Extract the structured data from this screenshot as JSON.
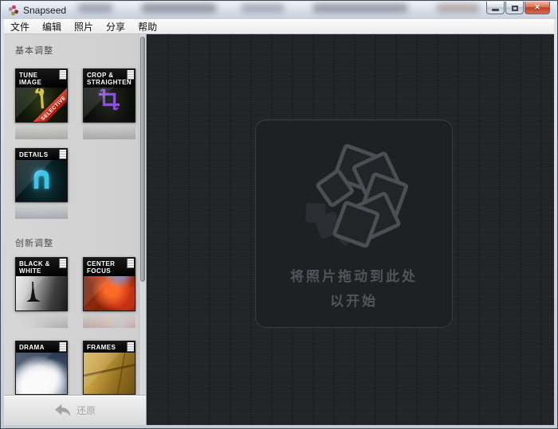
{
  "window": {
    "title": "Snapseed",
    "close_glyph": "✕"
  },
  "menu": {
    "items": [
      "文件",
      "编辑",
      "照片",
      "分享",
      "帮助"
    ]
  },
  "sidebar": {
    "sections": [
      {
        "label": "基本调整",
        "tiles": [
          {
            "label": "TUNE IMAGE",
            "ribbon": "SELECTIVE",
            "icon": "wrench-icon"
          },
          {
            "label": "CROP & STRAIGHTEN",
            "icon": "crop-icon"
          },
          {
            "label": "DETAILS",
            "icon": "sharpen-arch-icon"
          }
        ]
      },
      {
        "label": "创新调整",
        "tiles": [
          {
            "label": "BLACK & WHITE",
            "icon": "eiffel-photo"
          },
          {
            "label": "CENTER FOCUS",
            "icon": "bokeh-photo"
          },
          {
            "label": "DRAMA",
            "icon": "clouds-photo"
          },
          {
            "label": "FRAMES",
            "icon": "paper-photo"
          }
        ]
      }
    ]
  },
  "footer": {
    "revert_label": "还原"
  },
  "dropzone": {
    "line1": "将照片拖动到此处",
    "line2": "以开始"
  },
  "colors": {
    "ribbon_red": "#c23b2a",
    "close_button_red": "#c33d22",
    "canvas_bg": "#232428",
    "sidebar_bg": "#d2d2d2",
    "dropzone_text": "#53545a"
  }
}
